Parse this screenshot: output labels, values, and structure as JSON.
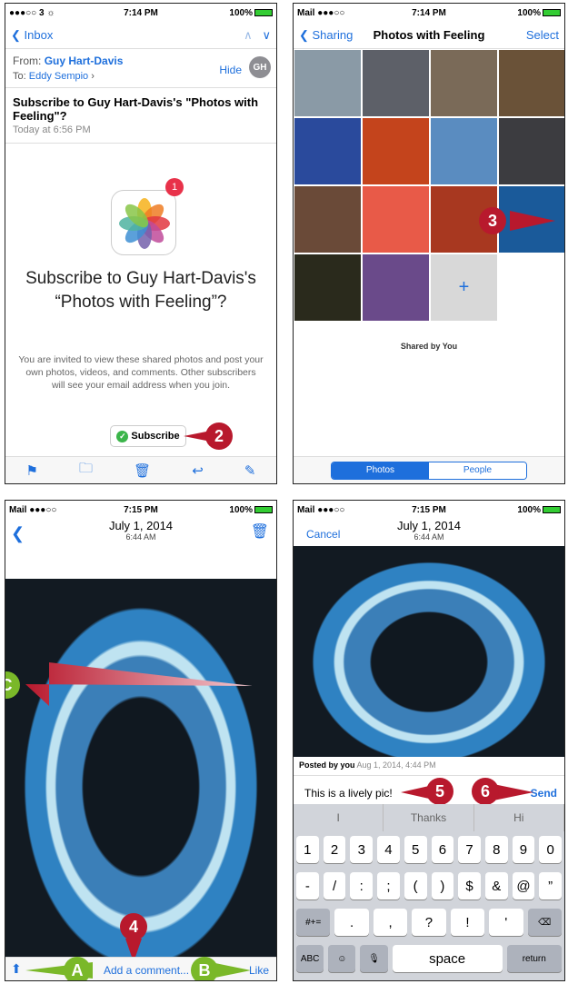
{
  "panel1": {
    "status": {
      "left": "●●●○○ 3 ☼",
      "time": "7:14 PM",
      "right": "100%"
    },
    "nav": {
      "back": "Inbox"
    },
    "header": {
      "from_label": "From:",
      "from_name": "Guy Hart-Davis",
      "to_label": "To:",
      "to_name": "Eddy Sempio",
      "hide": "Hide",
      "avatar": "GH"
    },
    "subject": {
      "title": "Subscribe to Guy Hart-Davis's \"Photos with Feeling\"?",
      "time": "Today at 6:56 PM"
    },
    "badge": "1",
    "big_title": "Subscribe to Guy Hart-Davis's “Photos with Feeling”?",
    "invite": "You are invited to view these shared photos and post your own photos, videos, and comments. Other subscribers will see your email address when you join.",
    "subscribe": "Subscribe",
    "callout": "2"
  },
  "panel2": {
    "status": {
      "left": "Mail ●●●○○",
      "time": "7:14 PM",
      "right": "100%"
    },
    "nav": {
      "back": "Sharing",
      "title": "Photos with Feeling",
      "select": "Select"
    },
    "shared_by": "Shared by You",
    "tabs": {
      "photos": "Photos",
      "people": "People"
    },
    "callout": "3",
    "tile_colors": [
      "#8a9aa6",
      "#5d6068",
      "#7a6a58",
      "#6a5238",
      "#2a4a9c",
      "#c4441c",
      "#5a8cc0",
      "#3c3c40",
      "#6a4a38",
      "#e85a48",
      "#a83820",
      "#1a5a9a",
      "#2a2a1c",
      "#6a4a8a",
      "#d8d8d8"
    ]
  },
  "panel3": {
    "status": {
      "left": "Mail ●●●○○",
      "time": "7:15 PM",
      "right": "100%"
    },
    "date": "July 1, 2014",
    "time": "6:44 AM",
    "comment": "Add a comment...",
    "like": "Like",
    "callouts": {
      "c": "C",
      "four": "4",
      "a": "A",
      "b": "B"
    }
  },
  "panel4": {
    "status": {
      "left": "Mail ●●●○○",
      "time": "7:15 PM",
      "right": "100%"
    },
    "cancel": "Cancel",
    "date": "July 1, 2014",
    "time": "6:44 AM",
    "posted_by": "Posted by you",
    "posted_date": "Aug 1, 2014, 4:44 PM",
    "comment_text": "This is a lively pic!",
    "send": "Send",
    "callouts": {
      "five": "5",
      "six": "6"
    },
    "suggestions": [
      "I",
      "Thanks",
      "Hi"
    ],
    "row1": [
      "1",
      "2",
      "3",
      "4",
      "5",
      "6",
      "7",
      "8",
      "9",
      "0"
    ],
    "row2": [
      "-",
      "/",
      ":",
      ";",
      "(",
      ")",
      "$",
      "&",
      "@",
      "”"
    ],
    "row3": [
      "#+=",
      ".",
      ",",
      "?",
      "!",
      "'",
      "⌫"
    ],
    "row4": [
      "ABC",
      "☺",
      "🎙",
      "space",
      "return"
    ]
  }
}
